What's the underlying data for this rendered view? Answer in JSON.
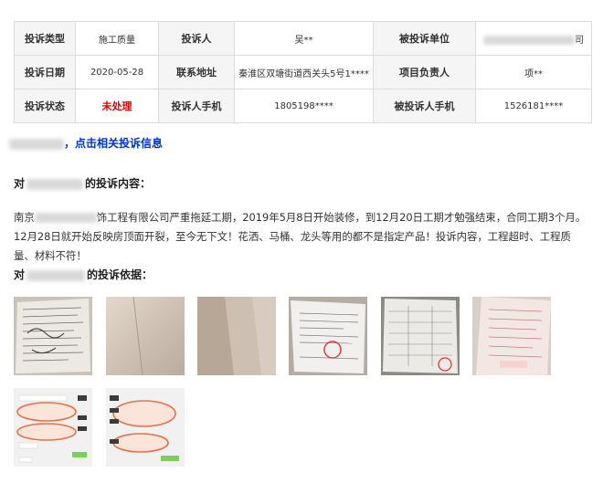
{
  "table": {
    "rows": [
      {
        "h1": "投诉类型",
        "v1": "施工质量",
        "h2": "投诉人",
        "v2": "吴**",
        "h3": "被投诉单位",
        "v3_suffix": "司"
      },
      {
        "h1": "投诉日期",
        "v1": "2020-05-28",
        "h2": "联系地址",
        "v2": "秦淮区双塘街道西关头5号1****",
        "h3": "项目负责人",
        "v3": "项**"
      },
      {
        "h1": "投诉状态",
        "v1": "未处理",
        "h2": "投诉人手机",
        "v2": "1805198****",
        "h3": "被投诉人手机",
        "v3": "1526181****"
      }
    ]
  },
  "related_link": "，点击相关投诉信息",
  "complaint_content_title": {
    "prefix": "对",
    "suffix": "的投诉内容："
  },
  "complaint_text": {
    "prefix": "南京",
    "body": "饰工程有限公司严重拖延工期，2019年5月8日开始装修，到12月20日工期才勉强结束，合同工期3个月。12月28日就开始反映房顶面开裂，至今无下文！花洒、马桶、龙头等用的都不是指定产品！投诉内容，工程超时、工程质量、材料不符！"
  },
  "evidence_title": {
    "prefix": "对",
    "suffix": "的投诉依据："
  },
  "colors": {
    "status_red": "#e60000",
    "link_blue": "#0033cc",
    "header_bg": "#f5f5f5"
  }
}
